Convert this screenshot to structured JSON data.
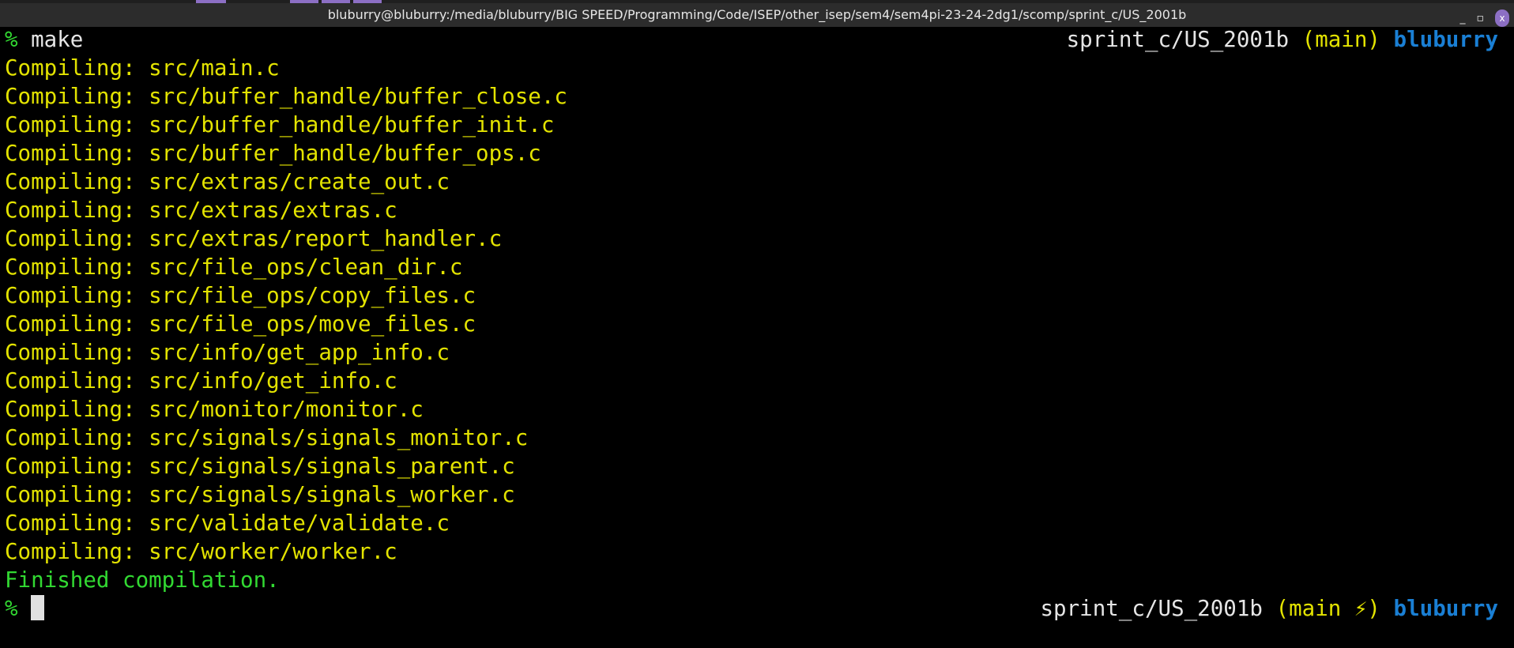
{
  "window": {
    "title": "bluburry@bluburry:/media/bluburry/BIG SPEED/Programming/Code/ISEP/other_isep/sem4/sem4pi-23-24-2dg1/scomp/sprint_c/US_2001b",
    "minimize": "_",
    "maximize": "▫",
    "close": "x"
  },
  "prompt": {
    "symbol": "%",
    "command": "make",
    "path": "sprint_c/US_2001b",
    "branch_first": "(main)",
    "branch_last": "(main ⚡)",
    "user": "bluburry"
  },
  "output": {
    "prefix": "Compiling: ",
    "files": [
      "src/main.c",
      "src/buffer_handle/buffer_close.c",
      "src/buffer_handle/buffer_init.c",
      "src/buffer_handle/buffer_ops.c",
      "src/extras/create_out.c",
      "src/extras/extras.c",
      "src/extras/report_handler.c",
      "src/file_ops/clean_dir.c",
      "src/file_ops/copy_files.c",
      "src/file_ops/move_files.c",
      "src/info/get_app_info.c",
      "src/info/get_info.c",
      "src/monitor/monitor.c",
      "src/signals/signals_monitor.c",
      "src/signals/signals_parent.c",
      "src/signals/signals_worker.c",
      "src/validate/validate.c",
      "src/worker/worker.c"
    ],
    "finished": "Finished compilation."
  },
  "colors": {
    "yellow": "#e3e300",
    "green": "#32d932",
    "blue": "#1a7fd4"
  }
}
